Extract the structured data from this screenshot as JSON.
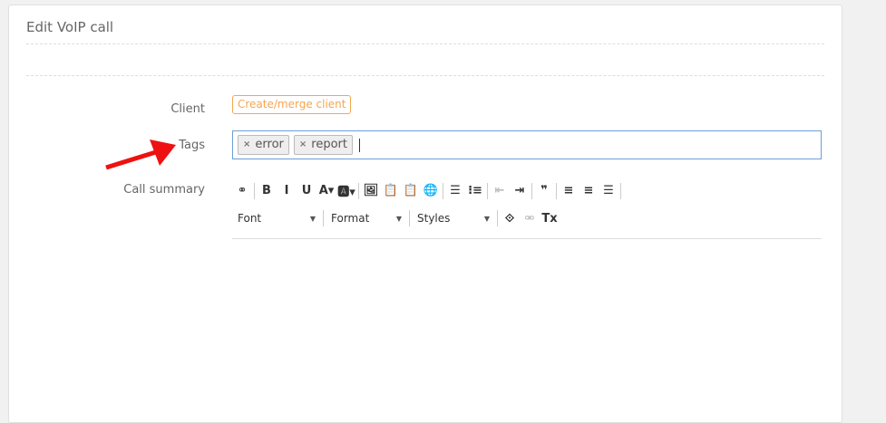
{
  "title": "Edit VoIP call",
  "fields": {
    "client_label": "Client",
    "client_button": "Create/merge client",
    "tags_label": "Tags",
    "summary_label": "Call summary"
  },
  "tags": [
    "error",
    "report"
  ],
  "tag_remove_glyph": "×",
  "toolbar": {
    "row1": [
      {
        "name": "link-icon",
        "glyph": "⚭"
      },
      "sep",
      {
        "name": "bold-icon",
        "glyph": "B"
      },
      {
        "name": "italic-icon",
        "glyph": "I"
      },
      {
        "name": "underline-icon",
        "glyph": "U"
      },
      {
        "name": "text-color-icon",
        "glyph": "A▾"
      },
      {
        "name": "background-color-icon",
        "glyph": "🅰▾"
      },
      "sep",
      {
        "name": "image-icon",
        "glyph": "🖼"
      },
      {
        "name": "paste-text-icon",
        "glyph": "📋"
      },
      {
        "name": "paste-word-icon",
        "glyph": "📋"
      },
      {
        "name": "globe-icon",
        "glyph": "🌐"
      },
      "sep",
      {
        "name": "numbered-list-icon",
        "glyph": "☰"
      },
      {
        "name": "bulleted-list-icon",
        "glyph": "⁝≡"
      },
      "sep",
      {
        "name": "outdent-icon",
        "glyph": "⇤",
        "disabled": true
      },
      {
        "name": "indent-icon",
        "glyph": "⇥"
      },
      "sep",
      {
        "name": "blockquote-icon",
        "glyph": "❞"
      },
      "sep",
      {
        "name": "align-left-icon",
        "glyph": "≡"
      },
      {
        "name": "align-center-icon",
        "glyph": "≡"
      },
      {
        "name": "justify-icon",
        "glyph": "☰"
      },
      "sep"
    ],
    "font": "Font",
    "format": "Format",
    "styles": "Styles",
    "row2_icons": [
      {
        "name": "source-icon",
        "glyph": "⟐"
      },
      {
        "name": "unlink-icon",
        "glyph": "⚮",
        "disabled": true
      },
      {
        "name": "remove-format-icon",
        "glyph": "Tx"
      }
    ]
  }
}
